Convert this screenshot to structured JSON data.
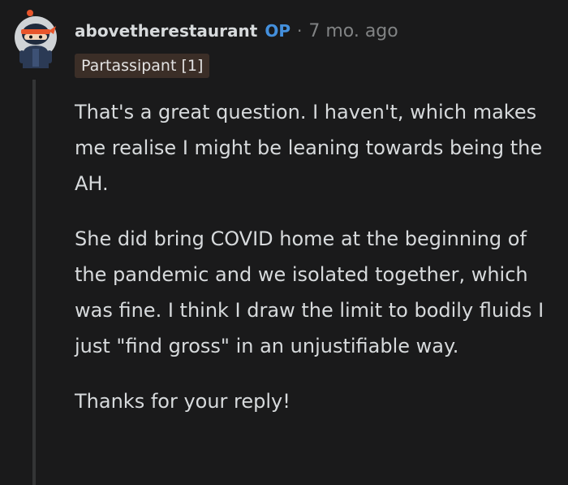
{
  "comment": {
    "author": "abovetherestaurant",
    "op_label": "OP",
    "separator": "·",
    "time_ago": "7 mo. ago",
    "flair": "Partassipant [1]",
    "paragraphs": [
      "That's a great question. I haven't, which makes me realise I might be leaning towards being the AH.",
      "She did bring COVID home at the beginning of the pandemic and we isolated together, which was fine. I think I draw the limit to bodily fluids I just \"find gross\" in an unjustifiable way.",
      "Thanks for your reply!"
    ]
  },
  "avatar_icon": "snoo-ninja-avatar",
  "colors": {
    "background": "#1a1a1b",
    "text": "#d7dadc",
    "meta": "#818384",
    "op": "#4490dd",
    "flair_bg": "#3b2e27",
    "thread_line": "#343536",
    "avatar_bandana": "#e8552b"
  }
}
